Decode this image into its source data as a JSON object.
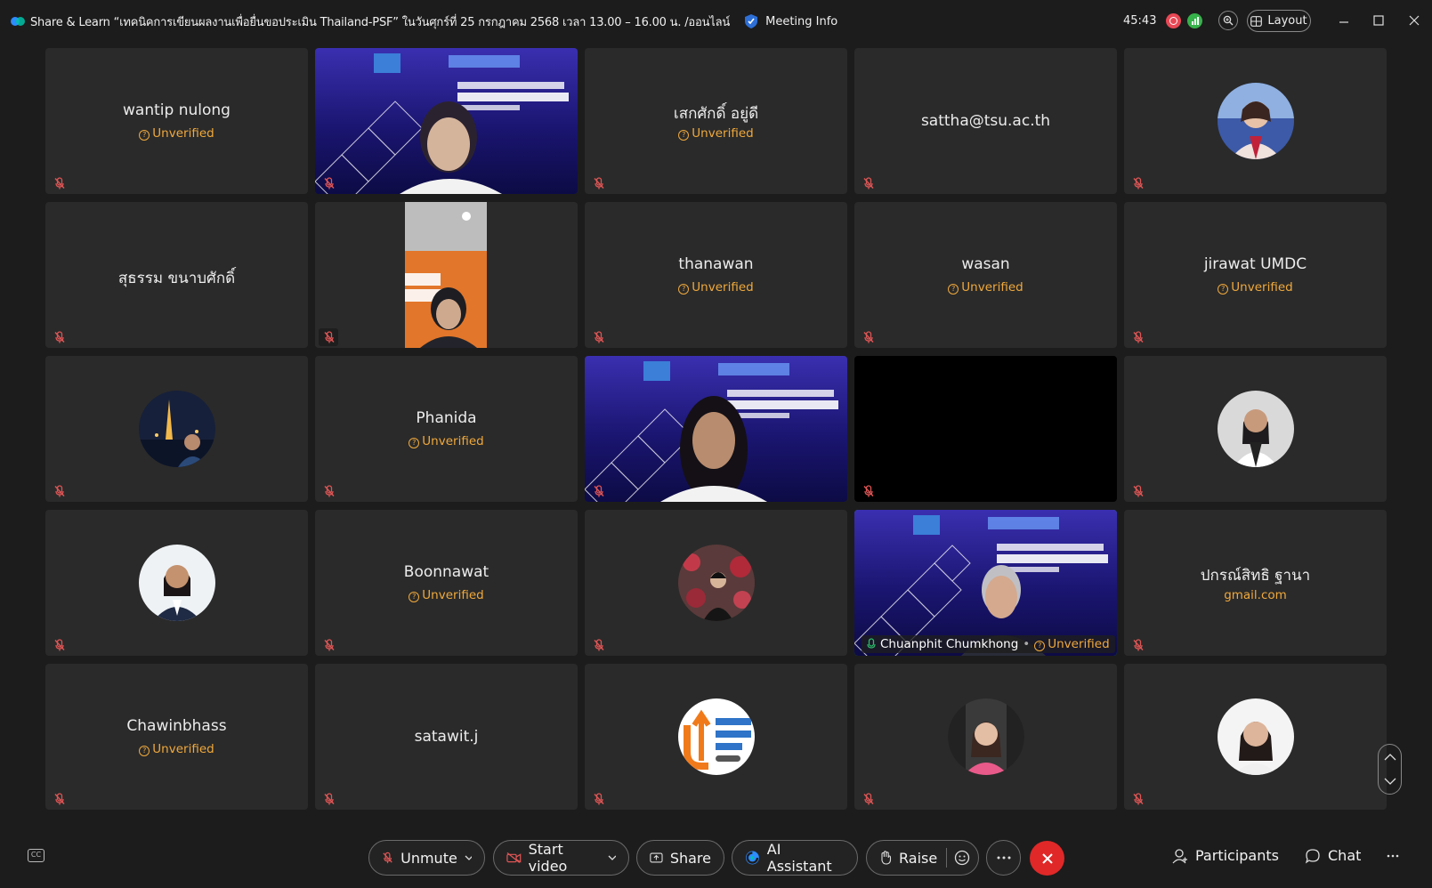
{
  "window": {
    "title": "Share & Learn “เทคนิคการเขียนผลงานเพื่อยื่นขอประเมิน Thailand-PSF” ในวันศุกร์ที่ 25 กรกฎาคม 2568 เวลา 13.00 – 16.00 น. /ออนไลน์",
    "meeting_info_label": "Meeting Info",
    "timer": "45:43",
    "layout_label": "Layout"
  },
  "colors": {
    "accent_unverified": "#f0a93c",
    "active_speaker_border": "#1aa68a",
    "end_button": "#e02828",
    "recording": "#e84855",
    "network_ok": "#36b24a"
  },
  "participants": {
    "wantip": {
      "name": "wantip nulong",
      "status": "Unverified"
    },
    "sek": {
      "name": "เสกศักดิ์ อยู่ดี",
      "status": "Unverified"
    },
    "sattha": {
      "name": "sattha@tsu.ac.th"
    },
    "suthum": {
      "name": "สุธรรม ขนาบศักดิ์"
    },
    "thanawan": {
      "name": "thanawan",
      "status": "Unverified"
    },
    "wasan": {
      "name": "wasan",
      "status": "Unverified"
    },
    "jirawat": {
      "name": "jirawat UMDC",
      "status": "Unverified"
    },
    "phanida": {
      "name": "Phanida",
      "status": "Unverified"
    },
    "boonnawat": {
      "name": "Boonnawat",
      "status": "Unverified"
    },
    "chuanphit": {
      "name": "Chuanphit Chumkhong",
      "status": "Unverified"
    },
    "porn": {
      "name": "ปกรณ์สิทธิ ฐานา",
      "status": "gmail.com"
    },
    "chawin": {
      "name": "Chawinbhass",
      "status": "Unverified"
    },
    "satawit": {
      "name": "satawit.j"
    }
  },
  "toolbar": {
    "cc_label": "CC",
    "unmute": "Unmute",
    "start_video": "Start video",
    "share": "Share",
    "ai_assistant": "AI Assistant",
    "raise": "Raise",
    "participants": "Participants",
    "chat": "Chat"
  },
  "icons": [
    "app-logo-icon",
    "shield-icon",
    "recording-icon",
    "network-icon",
    "zoom-icon",
    "layout-icon",
    "minimize-icon",
    "maximize-icon",
    "close-icon",
    "mic-muted-icon",
    "video-off-icon",
    "share-icon",
    "ai-icon",
    "hand-icon",
    "reaction-icon",
    "more-icon",
    "end-call-icon",
    "participants-icon",
    "chat-icon",
    "scroll-up-icon",
    "scroll-down-icon"
  ]
}
